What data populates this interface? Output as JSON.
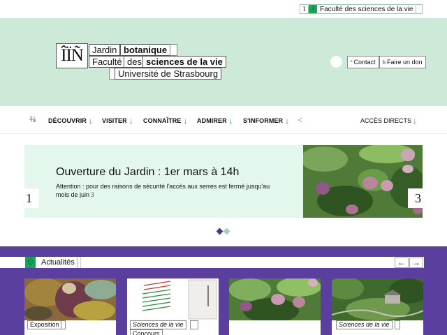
{
  "topbar": {
    "num": "1",
    "mark": "3",
    "faculty_link": "Faculté des sciences de la vie"
  },
  "logo": {
    "mark": "ÎÏÑ",
    "line1a": "Jardin",
    "line1b": "botanique",
    "line2a": "Faculté",
    "line2b": "des",
    "line2c": "sciences de la vie",
    "line3": "Université de Strasbourg"
  },
  "header_actions": {
    "contact_glyph": "º",
    "contact": "Contact",
    "donate_glyph": "h",
    "donate": "Faire un don"
  },
  "nav": {
    "menu_glyph": "¾",
    "items": [
      {
        "label": "DÉCOUVRIR",
        "arrow": "↓"
      },
      {
        "label": "VISITER",
        "arrow": "↓"
      },
      {
        "label": "CONNAÎTRE",
        "arrow": "↓"
      },
      {
        "label": "ADMIRER",
        "arrow": "↓"
      },
      {
        "label": "S'INFORMER",
        "arrow": "↓"
      }
    ],
    "search_glyph": "<",
    "acces": "ACCÈS DIRECTS",
    "acces_arrow": "↓"
  },
  "slider": {
    "title": "Ouverture du Jardin : 1er mars à 14h",
    "text": "Attention : pour des raisons de sécurité l'accès aux serres est fermé jusqu'au mois de juin",
    "text_glyph": "3",
    "prev": "1",
    "next": "3"
  },
  "news": {
    "mark": "Ú",
    "title": "Actualités",
    "prev": "←",
    "next": "→",
    "cards": [
      {
        "tag": "Exposition",
        "italic": false
      },
      {
        "tag": "Sciences de la vie",
        "italic": true,
        "tag2": "Concours"
      },
      {
        "tag": "",
        "italic": false
      },
      {
        "tag": "Sciences de la vie",
        "italic": true
      }
    ]
  },
  "colors": {
    "header_bg": "#cde9d8",
    "accent_green": "#1aa55b",
    "slide_bg": "#e3f7ed",
    "news_bg": "#5a3f9e"
  }
}
